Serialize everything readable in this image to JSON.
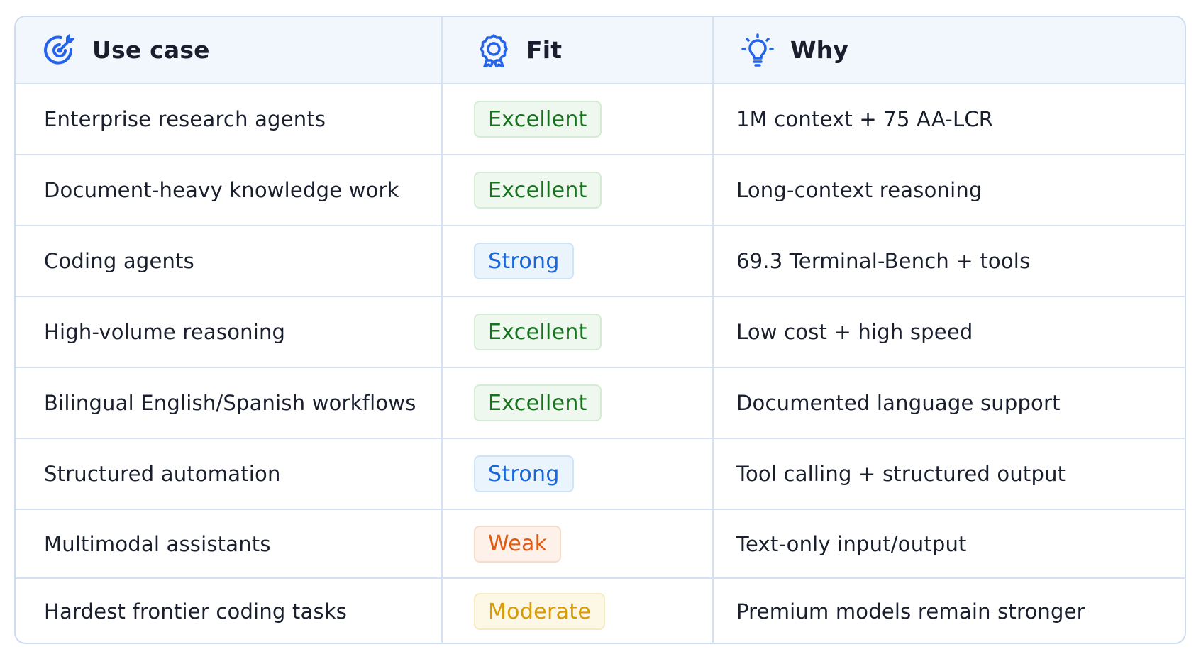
{
  "header": {
    "use_case": "Use case",
    "fit": "Fit",
    "why": "Why",
    "icons": {
      "use_case": "target-icon",
      "fit": "award-ribbon-icon",
      "why": "lightbulb-icon"
    },
    "accent": "#2563eb"
  },
  "rows": [
    {
      "use_case": "Enterprise research agents",
      "fit": "Excellent",
      "fit_level": "excellent",
      "why": "1M context + 75 AA-LCR"
    },
    {
      "use_case": "Document-heavy knowledge work",
      "fit": "Excellent",
      "fit_level": "excellent",
      "why": "Long-context reasoning"
    },
    {
      "use_case": "Coding agents",
      "fit": "Strong",
      "fit_level": "strong",
      "why": "69.3 Terminal-Bench + tools"
    },
    {
      "use_case": "High-volume reasoning",
      "fit": "Excellent",
      "fit_level": "excellent",
      "why": "Low cost + high speed"
    },
    {
      "use_case": "Bilingual English/Spanish workflows",
      "fit": "Excellent",
      "fit_level": "excellent",
      "why": "Documented language support"
    },
    {
      "use_case": "Structured automation",
      "fit": "Strong",
      "fit_level": "strong",
      "why": "Tool calling + structured output"
    },
    {
      "use_case": "Multimodal assistants",
      "fit": "Weak",
      "fit_level": "weak",
      "why": "Text-only input/output"
    },
    {
      "use_case": "Hardest frontier coding tasks",
      "fit": "Moderate",
      "fit_level": "moderate",
      "why": "Premium models remain stronger"
    }
  ],
  "colors": {
    "excellent": "#17741e",
    "strong": "#1967d8",
    "weak": "#e05a14",
    "moderate": "#d89b07"
  }
}
